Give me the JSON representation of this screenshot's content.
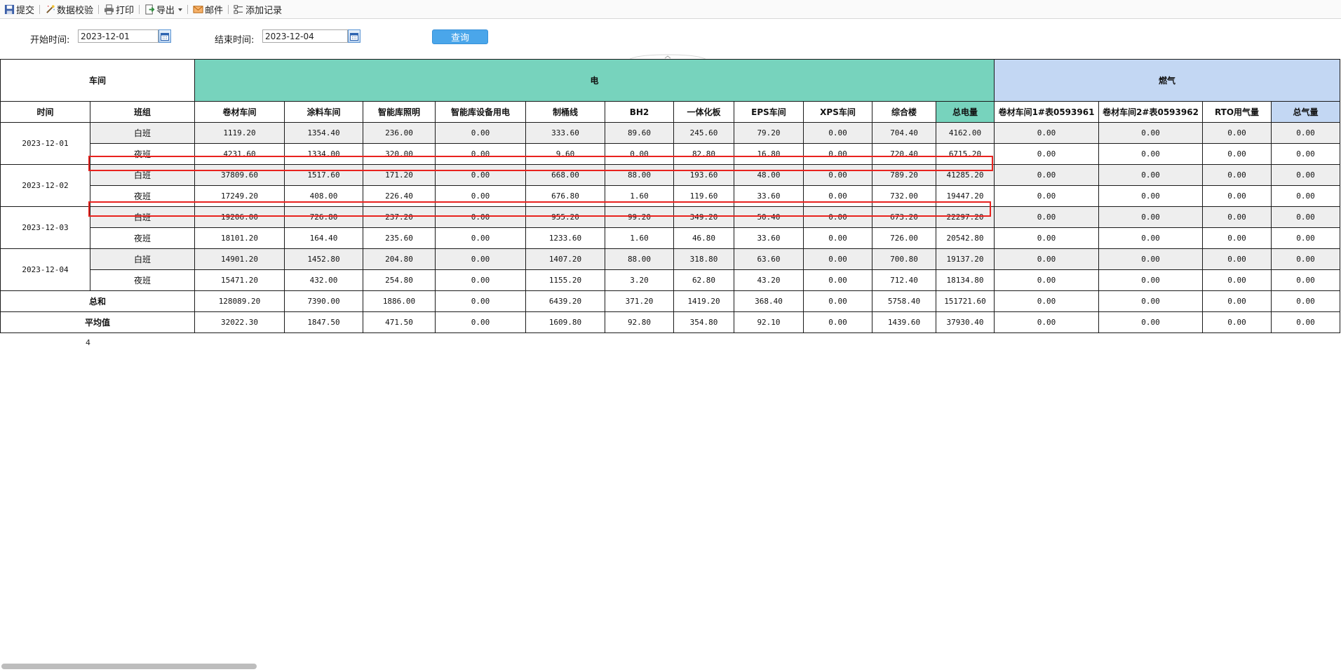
{
  "toolbar": {
    "items": [
      {
        "label": "提交",
        "icon": "save-icon"
      },
      {
        "label": "数据校验",
        "icon": "wand-icon"
      },
      {
        "label": "打印",
        "icon": "print-icon"
      },
      {
        "label": "导出",
        "icon": "export-icon"
      },
      {
        "label": "邮件",
        "icon": "mail-icon"
      },
      {
        "label": "添加记录",
        "icon": "add-record-icon"
      }
    ]
  },
  "filter": {
    "start_label": "开始时间:",
    "start_value": "2023-12-01",
    "end_label": "结束时间:",
    "end_value": "2023-12-04",
    "query_label": "查询"
  },
  "table": {
    "workshop_label": "车间",
    "group_elec": "电",
    "group_gas": "燃气",
    "time_label": "时间",
    "shift_label": "班组",
    "elec_columns": [
      "卷材车间",
      "涂料车间",
      "智能库照明",
      "智能库设备用电",
      "制桶线",
      "BH2",
      "一体化板",
      "EPS车间",
      "XPS车间",
      "综合楼",
      "总电量"
    ],
    "gas_columns": [
      "卷材车间1#表0593961",
      "卷材车间2#表0593962",
      "RTO用气量",
      "总气量"
    ],
    "rows": [
      {
        "date": "2023-12-01",
        "shift": "白班",
        "values": [
          "1119.20",
          "1354.40",
          "236.00",
          "0.00",
          "333.60",
          "89.60",
          "245.60",
          "79.20",
          "0.00",
          "704.40",
          "4162.00",
          "0.00",
          "0.00",
          "0.00",
          "0.00"
        ]
      },
      {
        "date": "2023-12-01",
        "shift": "夜班",
        "values": [
          "4231.60",
          "1334.00",
          "320.00",
          "0.00",
          "9.60",
          "0.00",
          "82.80",
          "16.80",
          "0.00",
          "720.40",
          "6715.20",
          "0.00",
          "0.00",
          "0.00",
          "0.00"
        ]
      },
      {
        "date": "2023-12-02",
        "shift": "白班",
        "values": [
          "37809.60",
          "1517.60",
          "171.20",
          "0.00",
          "668.00",
          "88.00",
          "193.60",
          "48.00",
          "0.00",
          "789.20",
          "41285.20",
          "0.00",
          "0.00",
          "0.00",
          "0.00"
        ]
      },
      {
        "date": "2023-12-02",
        "shift": "夜班",
        "values": [
          "17249.20",
          "408.00",
          "226.40",
          "0.00",
          "676.80",
          "1.60",
          "119.60",
          "33.60",
          "0.00",
          "732.00",
          "19447.20",
          "0.00",
          "0.00",
          "0.00",
          "0.00"
        ]
      },
      {
        "date": "2023-12-03",
        "shift": "白班",
        "values": [
          "19206.00",
          "726.80",
          "237.20",
          "0.00",
          "955.20",
          "99.20",
          "349.20",
          "50.40",
          "0.00",
          "673.20",
          "22297.20",
          "0.00",
          "0.00",
          "0.00",
          "0.00"
        ]
      },
      {
        "date": "2023-12-03",
        "shift": "夜班",
        "values": [
          "18101.20",
          "164.40",
          "235.60",
          "0.00",
          "1233.60",
          "1.60",
          "46.80",
          "33.60",
          "0.00",
          "726.00",
          "20542.80",
          "0.00",
          "0.00",
          "0.00",
          "0.00"
        ]
      },
      {
        "date": "2023-12-04",
        "shift": "白班",
        "values": [
          "14901.20",
          "1452.80",
          "204.80",
          "0.00",
          "1407.20",
          "88.00",
          "318.80",
          "63.60",
          "0.00",
          "700.80",
          "19137.20",
          "0.00",
          "0.00",
          "0.00",
          "0.00"
        ]
      },
      {
        "date": "2023-12-04",
        "shift": "夜班",
        "values": [
          "15471.20",
          "432.00",
          "254.80",
          "0.00",
          "1155.20",
          "3.20",
          "62.80",
          "43.20",
          "0.00",
          "712.40",
          "18134.80",
          "0.00",
          "0.00",
          "0.00",
          "0.00"
        ]
      }
    ],
    "summary": [
      {
        "label": "总和",
        "values": [
          "128089.20",
          "7390.00",
          "1886.00",
          "0.00",
          "6439.20",
          "371.20",
          "1419.20",
          "368.40",
          "0.00",
          "5758.40",
          "151721.60",
          "0.00",
          "0.00",
          "0.00",
          "0.00"
        ]
      },
      {
        "label": "平均值",
        "values": [
          "32022.30",
          "1847.50",
          "471.50",
          "0.00",
          "1609.80",
          "92.80",
          "354.80",
          "92.10",
          "0.00",
          "1439.60",
          "37930.40",
          "0.00",
          "0.00",
          "0.00",
          "0.00"
        ]
      }
    ]
  },
  "page_number": "4",
  "colors": {
    "elec_header": "#77d3bd",
    "gas_header": "#c3d7f3",
    "query_button": "#4aa6ea",
    "highlight": "#e8221e",
    "row_shade": "#eeeeee"
  }
}
